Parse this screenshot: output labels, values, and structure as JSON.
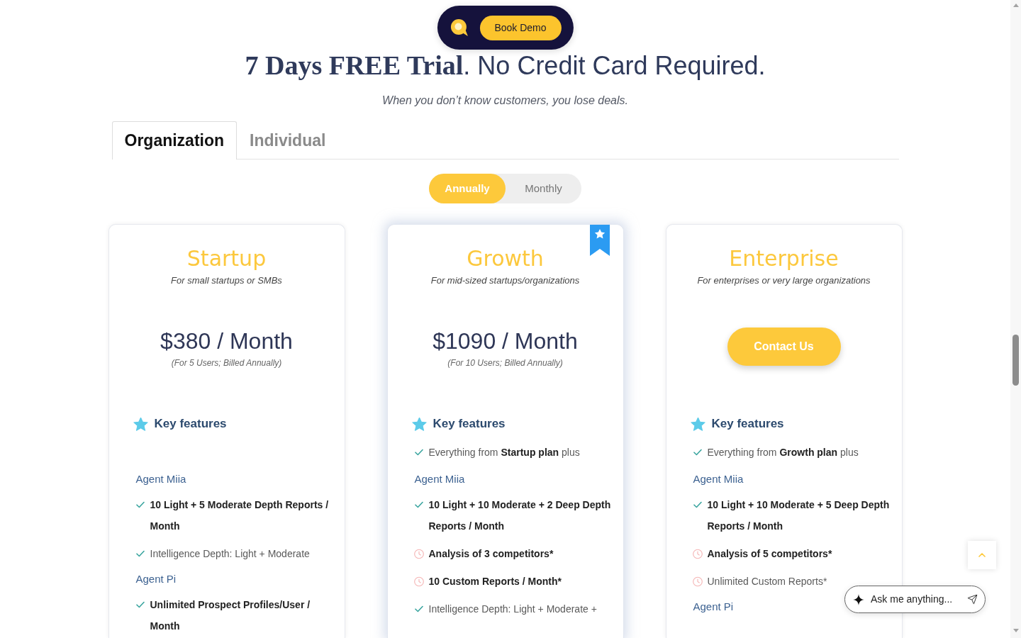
{
  "promo_bar": {
    "button": "Book Demo"
  },
  "headline": "**7 Days FREE Trial**. No Credit Card Required.",
  "tagline": "When you don’t know customers, you lose deals.",
  "tabs": [
    {
      "label": "Organization",
      "selected": true
    },
    {
      "label": "Individual",
      "selected": false
    }
  ],
  "billing_toggle": [
    {
      "label": "Annually",
      "selected": true
    },
    {
      "label": "Monthly",
      "selected": false
    }
  ],
  "plans": [
    {
      "name": "Startup",
      "description": "For small startups or SMBs",
      "price": "$380 / Month",
      "price_note": "(For 5 Users; Billed Annually)",
      "featured": false,
      "features_title": "Key features",
      "features": [
        {
          "kind": "section",
          "text": "Agent Miia"
        },
        {
          "kind": "check",
          "text": "10 Light + 5 Moderate Depth Reports / Month",
          "bold": true
        },
        {
          "kind": "check",
          "text": "Intelligence Depth: Light + Moderate",
          "bold": false
        },
        {
          "kind": "section",
          "text": "Agent Pi"
        },
        {
          "kind": "check",
          "text": "Unlimited Prospect Profiles/User / Month",
          "bold": true
        }
      ]
    },
    {
      "name": "Growth",
      "description": "For mid-sized startups/organizations",
      "price": "$1090 / Month",
      "price_note": "(For 10 Users; Billed Annually)",
      "featured": true,
      "features_title": "Key features",
      "intro": "Everything from **Startup plan** plus",
      "features": [
        {
          "kind": "section",
          "text": "Agent Miia"
        },
        {
          "kind": "check",
          "text": "10 Light + 10 Moderate + 2 Deep Depth Reports / Month",
          "bold": true
        },
        {
          "kind": "clock",
          "text": "Analysis of 3 competitors*",
          "bold": true
        },
        {
          "kind": "clock",
          "text": "10 Custom Reports / Month*",
          "bold": true
        },
        {
          "kind": "check",
          "text": "Intelligence Depth: Light + Moderate +",
          "bold": false
        }
      ]
    },
    {
      "name": "Enterprise",
      "description": "For enterprises or very large organizations",
      "cta": "Contact Us",
      "featured": false,
      "features_title": "Key features",
      "intro": "Everything from **Growth plan** plus",
      "features": [
        {
          "kind": "section",
          "text": "Agent Miia"
        },
        {
          "kind": "check",
          "text": "10 Light + 10 Moderate + 5 Deep Depth Reports / Month",
          "bold": true
        },
        {
          "kind": "clock",
          "text": "Analysis of 5 competitors*",
          "bold": true
        },
        {
          "kind": "clock",
          "text": "Unlimited Custom Reports*",
          "bold": false
        },
        {
          "kind": "section",
          "text": "Agent Pi"
        }
      ]
    }
  ],
  "chat_input": {
    "placeholder": "Ask me anything..."
  }
}
